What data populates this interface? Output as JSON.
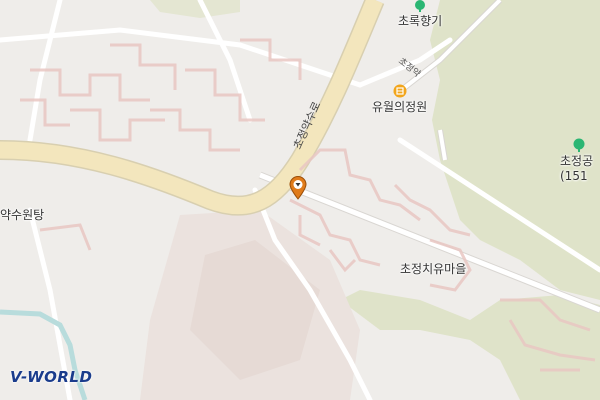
{
  "map": {
    "labels": {
      "chorok_hyanggi": "초록향기",
      "yuwol_garden": "유월의정원",
      "chojeong_park": "초정공",
      "chojeong_park_num": "(151",
      "yaksu_wontang": "약수원탕",
      "chojeong_healing": "초정치유마을",
      "road_main": "초정약수로",
      "road_small": "초정약"
    },
    "pois": [
      {
        "id": "chorok_hyanggi",
        "icon": "park-icon",
        "color": "#2bb673"
      },
      {
        "id": "yuwol_garden",
        "icon": "building-icon",
        "color": "#f2a51a"
      },
      {
        "id": "chojeong_park",
        "icon": "park-icon",
        "color": "#2bb673"
      }
    ],
    "marker": {
      "icon": "location-pin-icon",
      "color": "#e07b1a"
    },
    "colors": {
      "background": "#efedea",
      "forest": "#dfe3c9",
      "main_road": "#f3e6bd",
      "building_outline": "#e9c7c3",
      "water": "#b8dcdc"
    }
  },
  "logo": {
    "text": "V-WORLD"
  }
}
